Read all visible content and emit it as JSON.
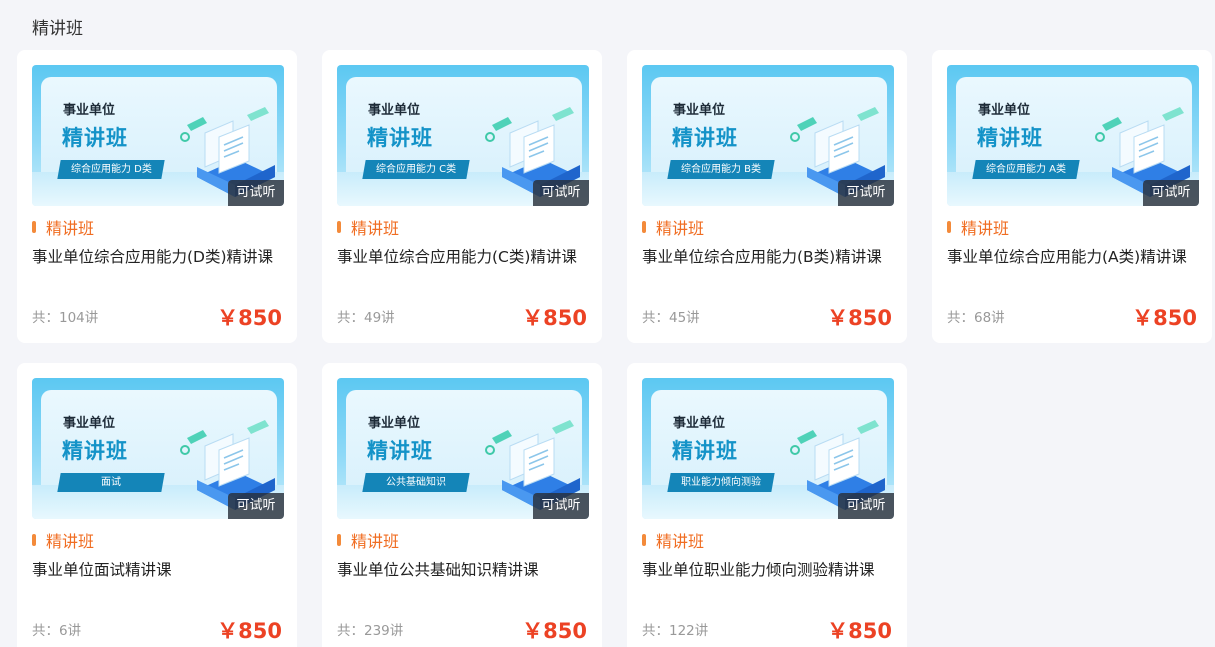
{
  "section": {
    "title": "精讲班"
  },
  "colors": {
    "accent": "#ec4224",
    "category": "#f06d22",
    "thumbnail_blue": "#1493c8"
  },
  "cards": [
    {
      "thumb_top": "事业单位",
      "thumb_main": "精讲班",
      "thumb_tag": "综合应用能力 D类",
      "trial": "可试听",
      "category": "精讲班",
      "title": "事业单位综合应用能力(D类)精讲课",
      "lessons": "共：104讲",
      "price": "￥850"
    },
    {
      "thumb_top": "事业单位",
      "thumb_main": "精讲班",
      "thumb_tag": "综合应用能力 C类",
      "trial": "可试听",
      "category": "精讲班",
      "title": "事业单位综合应用能力(C类)精讲课",
      "lessons": "共：49讲",
      "price": "￥850"
    },
    {
      "thumb_top": "事业单位",
      "thumb_main": "精讲班",
      "thumb_tag": "综合应用能力 B类",
      "trial": "可试听",
      "category": "精讲班",
      "title": "事业单位综合应用能力(B类)精讲课",
      "lessons": "共：45讲",
      "price": "￥850"
    },
    {
      "thumb_top": "事业单位",
      "thumb_main": "精讲班",
      "thumb_tag": "综合应用能力 A类",
      "trial": "可试听",
      "category": "精讲班",
      "title": "事业单位综合应用能力(A类)精讲课",
      "lessons": "共：68讲",
      "price": "￥850"
    },
    {
      "thumb_top": "事业单位",
      "thumb_main": "精讲班",
      "thumb_tag": "面试",
      "trial": "可试听",
      "category": "精讲班",
      "title": "事业单位面试精讲课",
      "lessons": "共：6讲",
      "price": "￥850"
    },
    {
      "thumb_top": "事业单位",
      "thumb_main": "精讲班",
      "thumb_tag": "公共基础知识",
      "trial": "可试听",
      "category": "精讲班",
      "title": "事业单位公共基础知识精讲课",
      "lessons": "共：239讲",
      "price": "￥850"
    },
    {
      "thumb_top": "事业单位",
      "thumb_main": "精讲班",
      "thumb_tag": "职业能力倾向测验",
      "trial": "可试听",
      "category": "精讲班",
      "title": "事业单位职业能力倾向测验精讲课",
      "lessons": "共：122讲",
      "price": "￥850"
    }
  ]
}
